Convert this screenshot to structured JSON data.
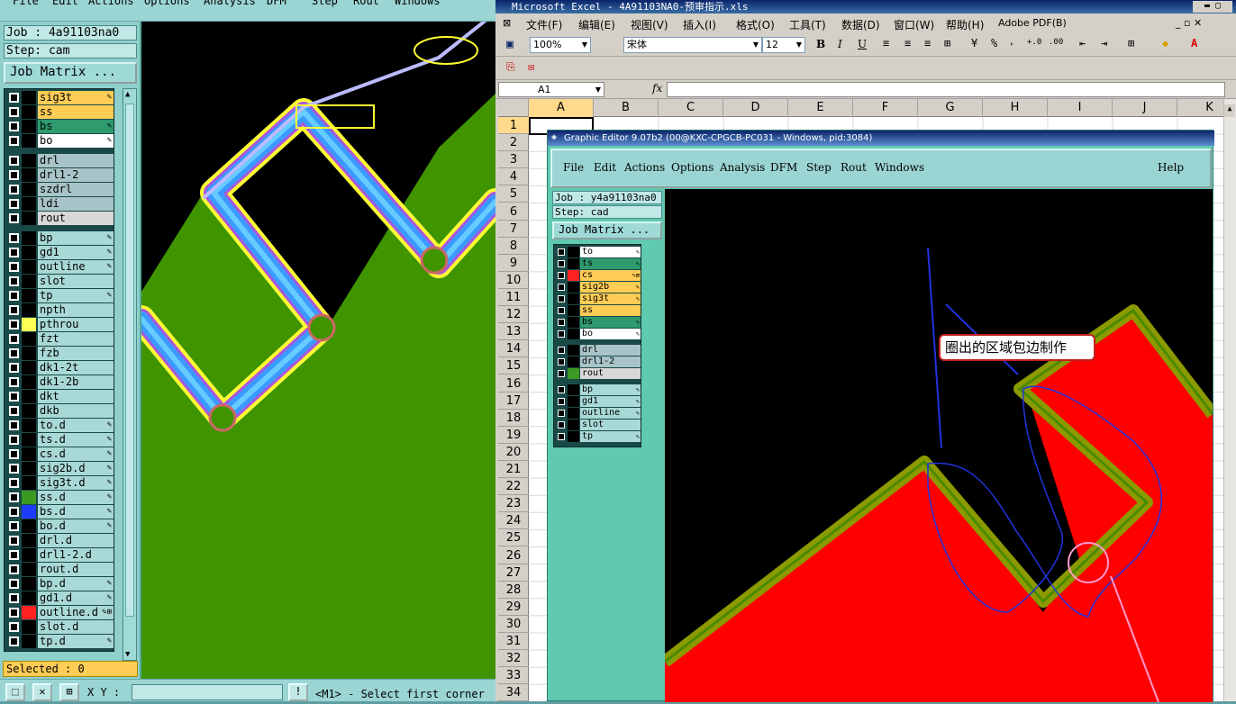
{
  "left_window": {
    "menu": [
      "File",
      "Edit",
      "Actions",
      "Options",
      "Analysis",
      "DFM",
      "Step",
      "Rout",
      "Windows"
    ],
    "job_label": "Job : 4a91103na0",
    "step_label": "Step: cam",
    "job_matrix_button": "Job Matrix ...",
    "layers": [
      {
        "name": "sig3t",
        "color": "#ffcc55",
        "swatch": "#000000",
        "mark": "✎"
      },
      {
        "name": "ss",
        "color": "#ffcc55",
        "swatch": "#000000",
        "mark": ""
      },
      {
        "name": "bs",
        "color": "#2e9a6e",
        "swatch": "#000000",
        "mark": "✎"
      },
      {
        "name": "bo",
        "color": "#ffffff",
        "swatch": "#000000",
        "mark": "✎"
      },
      {
        "name": "drl",
        "color": "#a9c4c8",
        "swatch": "#000000",
        "mark": ""
      },
      {
        "name": "drl1-2",
        "color": "#a9c4c8",
        "swatch": "#000000",
        "mark": ""
      },
      {
        "name": "szdrl",
        "color": "#a9c4c8",
        "swatch": "#000000",
        "mark": ""
      },
      {
        "name": "ldi",
        "color": "#a9c4c8",
        "swatch": "#000000",
        "mark": ""
      },
      {
        "name": "rout",
        "color": "#d8d8d8",
        "swatch": "#000000",
        "mark": ""
      },
      {
        "name": "bp",
        "color": "#a9d9d6",
        "swatch": "#000000",
        "mark": "✎"
      },
      {
        "name": "gd1",
        "color": "#a9d9d6",
        "swatch": "#000000",
        "mark": "✎"
      },
      {
        "name": "outline",
        "color": "#a9d9d6",
        "swatch": "#000000",
        "mark": "✎"
      },
      {
        "name": "slot",
        "color": "#a9d9d6",
        "swatch": "#000000",
        "mark": ""
      },
      {
        "name": "tp",
        "color": "#a9d9d6",
        "swatch": "#000000",
        "mark": "✎"
      },
      {
        "name": "npth",
        "color": "#a9d9d6",
        "swatch": "#000000",
        "mark": ""
      },
      {
        "name": "pthrou",
        "color": "#a9d9d6",
        "swatch": "#ffff55",
        "mark": ""
      },
      {
        "name": "fzt",
        "color": "#a9d9d6",
        "swatch": "#000000",
        "mark": ""
      },
      {
        "name": "fzb",
        "color": "#a9d9d6",
        "swatch": "#000000",
        "mark": ""
      },
      {
        "name": "dk1-2t",
        "color": "#a9d9d6",
        "swatch": "#000000",
        "mark": ""
      },
      {
        "name": "dk1-2b",
        "color": "#a9d9d6",
        "swatch": "#000000",
        "mark": ""
      },
      {
        "name": "dkt",
        "color": "#a9d9d6",
        "swatch": "#000000",
        "mark": ""
      },
      {
        "name": "dkb",
        "color": "#a9d9d6",
        "swatch": "#000000",
        "mark": ""
      },
      {
        "name": "to.d",
        "color": "#a9d9d6",
        "swatch": "#000000",
        "mark": "✎"
      },
      {
        "name": "ts.d",
        "color": "#a9d9d6",
        "swatch": "#000000",
        "mark": "✎"
      },
      {
        "name": "cs.d",
        "color": "#a9d9d6",
        "swatch": "#000000",
        "mark": "✎"
      },
      {
        "name": "sig2b.d",
        "color": "#a9d9d6",
        "swatch": "#000000",
        "mark": "✎"
      },
      {
        "name": "sig3t.d",
        "color": "#a9d9d6",
        "swatch": "#000000",
        "mark": "✎"
      },
      {
        "name": "ss.d",
        "color": "#a9d9d6",
        "swatch": "#3a9a22",
        "mark": "✎"
      },
      {
        "name": "bs.d",
        "color": "#a9d9d6",
        "swatch": "#1e3cff",
        "mark": "✎"
      },
      {
        "name": "bo.d",
        "color": "#a9d9d6",
        "swatch": "#000000",
        "mark": "✎"
      },
      {
        "name": "drl.d",
        "color": "#a9d9d6",
        "swatch": "#000000",
        "mark": ""
      },
      {
        "name": "drl1-2.d",
        "color": "#a9d9d6",
        "swatch": "#000000",
        "mark": ""
      },
      {
        "name": "rout.d",
        "color": "#a9d9d6",
        "swatch": "#000000",
        "mark": ""
      },
      {
        "name": "bp.d",
        "color": "#a9d9d6",
        "swatch": "#000000",
        "mark": "✎"
      },
      {
        "name": "gd1.d",
        "color": "#a9d9d6",
        "swatch": "#000000",
        "mark": "✎"
      },
      {
        "name": "outline.d",
        "color": "#a9d9d6",
        "swatch": "#ff2222",
        "mark": "✎⊞"
      },
      {
        "name": "slot.d",
        "color": "#a9d9d6",
        "swatch": "#000000",
        "mark": ""
      },
      {
        "name": "tp.d",
        "color": "#a9d9d6",
        "swatch": "#000000",
        "mark": "✎"
      }
    ],
    "selected_label": "Selected : 0",
    "xy_label": "X Y :",
    "status_text": "<M1> - Select first corner"
  },
  "excel": {
    "title": "Microsoft Excel - 4A91103NA0-预审指示.xls",
    "menu": [
      "文件(F)",
      "编辑(E)",
      "视图(V)",
      "插入(I)",
      "格式(O)",
      "工具(T)",
      "数据(D)",
      "窗口(W)",
      "帮助(H)",
      "Adobe PDF(B)"
    ],
    "zoom": "100%",
    "font_name": "宋体",
    "font_size": "12",
    "name_box": "A1",
    "fx": "fx",
    "columns": [
      "A",
      "B",
      "C",
      "D",
      "E",
      "F",
      "G",
      "H",
      "I",
      "J",
      "K"
    ],
    "rows": [
      "1",
      "2",
      "3",
      "4",
      "5",
      "6",
      "7",
      "8",
      "9",
      "10",
      "11",
      "12",
      "13",
      "14",
      "15",
      "16",
      "17",
      "18",
      "19",
      "20",
      "21",
      "22",
      "23",
      "24",
      "25",
      "26",
      "27",
      "28",
      "29",
      "30",
      "31",
      "32",
      "33",
      "34"
    ]
  },
  "graphic_editor": {
    "title": "Graphic Editor 9.07b2 (00@KXC-CPGCB-PC031 - Windows, pid:3084)",
    "menu": [
      "File",
      "Edit",
      "Actions",
      "Options",
      "Analysis",
      "DFM",
      "Step",
      "Rout",
      "Windows",
      "Help"
    ],
    "job_label": "Job : y4a91103na0",
    "step_label": "Step: cad",
    "job_matrix_button": "Job Matrix ...",
    "layers": [
      {
        "name": "to",
        "color": "#ffffff",
        "swatch": "#000000",
        "mark": "✎"
      },
      {
        "name": "ts",
        "color": "#2e9a6e",
        "swatch": "#000000",
        "mark": "✎"
      },
      {
        "name": "cs",
        "color": "#ffcc55",
        "swatch": "#ff2222",
        "mark": "✎⊞"
      },
      {
        "name": "sig2b",
        "color": "#ffcc55",
        "swatch": "#000000",
        "mark": "✎"
      },
      {
        "name": "sig3t",
        "color": "#ffcc55",
        "swatch": "#000000",
        "mark": "✎"
      },
      {
        "name": "ss",
        "color": "#ffcc55",
        "swatch": "#000000",
        "mark": ""
      },
      {
        "name": "bs",
        "color": "#2e9a6e",
        "swatch": "#000000",
        "mark": "✎"
      },
      {
        "name": "bo",
        "color": "#ffffff",
        "swatch": "#000000",
        "mark": "✎"
      },
      {
        "name": "drl",
        "color": "#a9c4c8",
        "swatch": "#000000",
        "mark": ""
      },
      {
        "name": "drl1-2",
        "color": "#a9c4c8",
        "swatch": "#000000",
        "mark": ""
      },
      {
        "name": "rout",
        "color": "#d8d8d8",
        "swatch": "#3a9a22",
        "mark": ""
      },
      {
        "name": "bp",
        "color": "#a9d9d6",
        "swatch": "#000000",
        "mark": "✎"
      },
      {
        "name": "gd1",
        "color": "#a9d9d6",
        "swatch": "#000000",
        "mark": "✎"
      },
      {
        "name": "outline",
        "color": "#a9d9d6",
        "swatch": "#000000",
        "mark": "✎"
      },
      {
        "name": "slot",
        "color": "#a9d9d6",
        "swatch": "#000000",
        "mark": ""
      },
      {
        "name": "tp",
        "color": "#a9d9d6",
        "swatch": "#000000",
        "mark": "✎"
      }
    ],
    "annotation": "圈出的区域包边制作"
  }
}
